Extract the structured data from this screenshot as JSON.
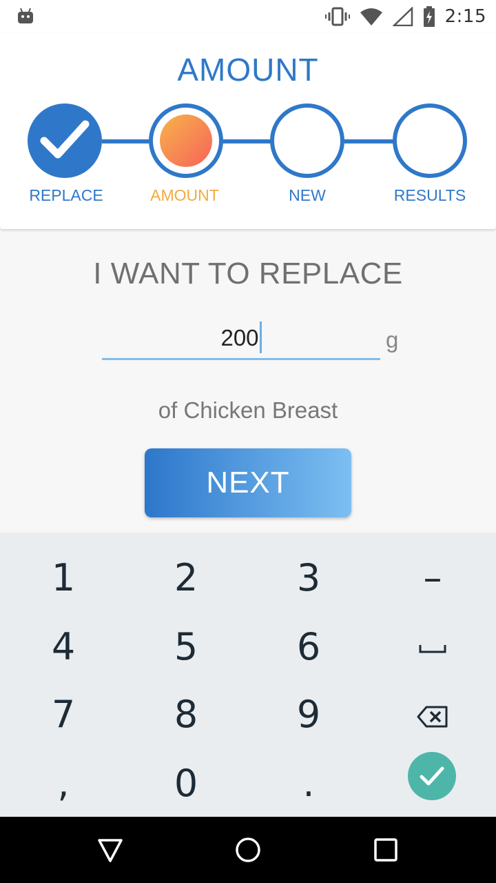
{
  "status_bar": {
    "time": "2:15",
    "icons": [
      "android-icon",
      "vibrate-icon",
      "wifi-icon",
      "signal-icon",
      "battery-charging-icon"
    ]
  },
  "stepper": {
    "title": "AMOUNT",
    "steps": [
      {
        "label": "REPLACE",
        "state": "done"
      },
      {
        "label": "AMOUNT",
        "state": "active"
      },
      {
        "label": "NEW",
        "state": "pending"
      },
      {
        "label": "RESULTS",
        "state": "pending"
      }
    ]
  },
  "form": {
    "heading": "I WANT TO REPLACE",
    "amount_value": "200",
    "unit": "g",
    "food_text": "of Chicken Breast",
    "next_label": "NEXT"
  },
  "keyboard": {
    "keys": [
      "1",
      "2",
      "3",
      "–",
      "4",
      "5",
      "6",
      "7",
      "8",
      "9",
      ",",
      "0",
      "."
    ],
    "icons": [
      "space-icon",
      "backspace-icon",
      "done-check-icon"
    ]
  },
  "nav_bar": {
    "icons": [
      "back-icon",
      "home-icon",
      "recents-icon"
    ]
  },
  "colors": {
    "primary": "#2f78c9",
    "active_step": "#f2ab41",
    "done_key": "#4db6a9",
    "keyboard_bg": "#e9edf0"
  }
}
